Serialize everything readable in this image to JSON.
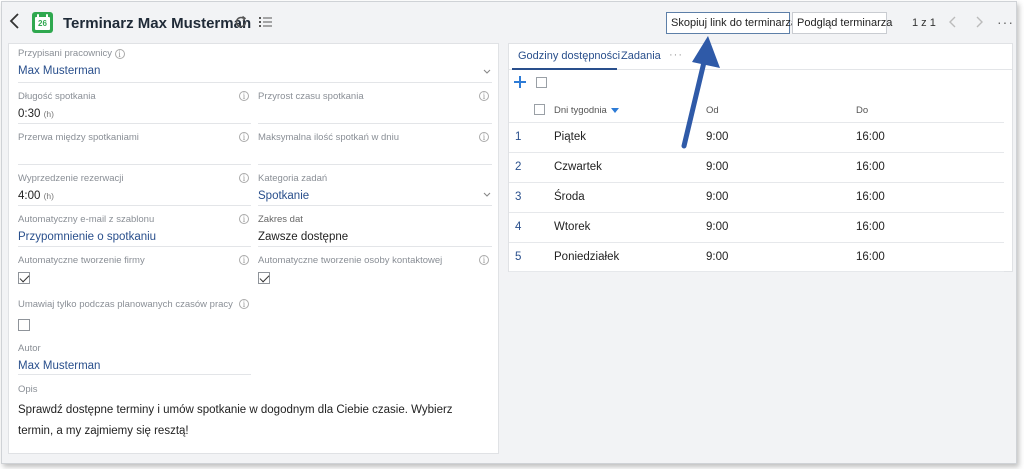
{
  "header": {
    "title": "Terminarz Max Musterman",
    "app_icon_day": "26",
    "copy_link_label": "Skopiuj link do terminarza",
    "preview_label": "Podgląd terminarza",
    "pager": "1 z 1",
    "more": "···"
  },
  "form": {
    "employees": {
      "label": "Przypisani pracownicy",
      "value": "Max Musterman"
    },
    "duration": {
      "label": "Długość spotkania",
      "value": "0:30",
      "unit": "(h)"
    },
    "increment": {
      "label": "Przyrost czasu spotkania",
      "value": ""
    },
    "break": {
      "label": "Przerwa między spotkaniami",
      "value": ""
    },
    "max_meetings": {
      "label": "Maksymalna ilość spotkań w dniu",
      "value": ""
    },
    "advance": {
      "label": "Wyprzedzenie rezerwacji",
      "value": "4:00",
      "unit": "(h)"
    },
    "task_category": {
      "label": "Kategoria zadań",
      "value": "Spotkanie"
    },
    "auto_email": {
      "label": "Automatyczny e-mail z szablonu",
      "value": "Przypomnienie o spotkaniu"
    },
    "date_range": {
      "label": "Zakres dat",
      "value": "Zawsze dostępne"
    },
    "auto_company": {
      "label": "Automatyczne tworzenie firmy",
      "checked": true
    },
    "auto_contact": {
      "label": "Automatyczne tworzenie osoby kontaktowej",
      "checked": true
    },
    "work_hours_only": {
      "label": "Umawiaj tylko podczas planowanych czasów pracy",
      "checked": false
    },
    "author": {
      "label": "Autor",
      "value": "Max Musterman"
    },
    "description": {
      "label": "Opis",
      "value": "Sprawdź dostępne terminy i umów spotkanie w dogodnym dla Ciebie czasie. Wybierz termin, a my zajmiemy się resztą!"
    }
  },
  "tabs": [
    {
      "label": "Godziny dostępności",
      "active": true
    },
    {
      "label": "Zadania",
      "active": false
    }
  ],
  "tabs_more": "···",
  "table": {
    "columns": [
      "Dni tygodnia",
      "Od",
      "Do"
    ],
    "rows": [
      {
        "num": "1",
        "day": "Piątek",
        "from": "9:00",
        "to": "16:00"
      },
      {
        "num": "2",
        "day": "Czwartek",
        "from": "9:00",
        "to": "16:00"
      },
      {
        "num": "3",
        "day": "Środa",
        "from": "9:00",
        "to": "16:00"
      },
      {
        "num": "4",
        "day": "Wtorek",
        "from": "9:00",
        "to": "16:00"
      },
      {
        "num": "5",
        "day": "Poniedziałek",
        "from": "9:00",
        "to": "16:00"
      }
    ]
  },
  "colors": {
    "accent": "#294f8c",
    "brand_green": "#2fa84f",
    "annotation_arrow": "#2f5aa8"
  }
}
